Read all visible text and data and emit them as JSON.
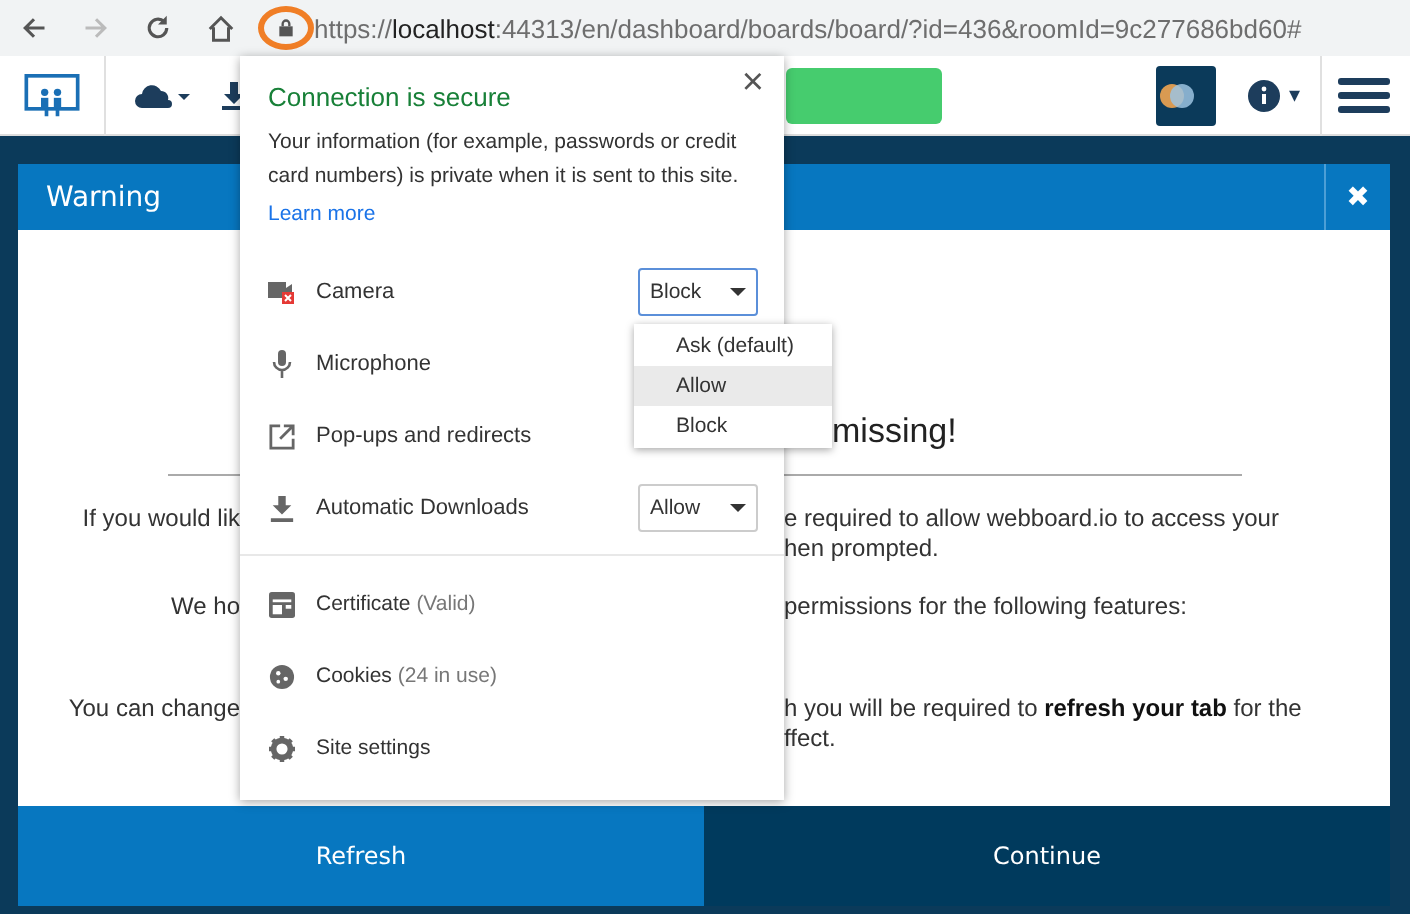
{
  "browser": {
    "url": {
      "scheme": "https://",
      "host": "localhost",
      "rest": ":44313/en/dashboard/boards/board/?id=436&roomId=9c277686bd60#"
    },
    "forward_disabled": true,
    "lock_highlighted": true
  },
  "toolbar": {
    "info_caret": "▾"
  },
  "modal": {
    "title": "Warning",
    "close": "✖",
    "heading": "missing!",
    "lines": [
      {
        "left": "If you would lik",
        "right": "e required to allow webboard.io to access your"
      },
      {
        "right": "hen prompted."
      },
      {
        "left": "We ho",
        "right": "permissions for the following features:"
      },
      {
        "left": "You can change",
        "right": "h you will be required to **refresh your tab** for the"
      },
      {
        "right": "ffect."
      }
    ],
    "buttons": [
      {
        "label": "Refresh",
        "kind": "primary"
      },
      {
        "label": "Continue",
        "kind": "secondary"
      }
    ]
  },
  "site_info": {
    "title": "Connection is secure",
    "close": "×",
    "description": "Your information (for example, passwords or credit card numbers) is private when it is sent to this site.",
    "link": "Learn more",
    "permissions": [
      {
        "label": "Camera",
        "blocked": true,
        "value": "Block",
        "focused": true
      },
      {
        "label": "Microphone",
        "blocked": false
      },
      {
        "label": "Pop-ups and redirects",
        "blocked": false
      },
      {
        "label": "Automatic Downloads",
        "blocked": false,
        "value": "Allow",
        "focused": false
      }
    ],
    "menu": [
      {
        "label": "Ask (default)",
        "highlighted": false
      },
      {
        "label": "Allow",
        "highlighted": true
      },
      {
        "label": "Block",
        "highlighted": false
      }
    ],
    "links": [
      {
        "label": "Certificate",
        "detail": "(Valid)"
      },
      {
        "label": "Cookies",
        "detail": "(24 in use)"
      },
      {
        "label": "Site settings"
      }
    ]
  }
}
